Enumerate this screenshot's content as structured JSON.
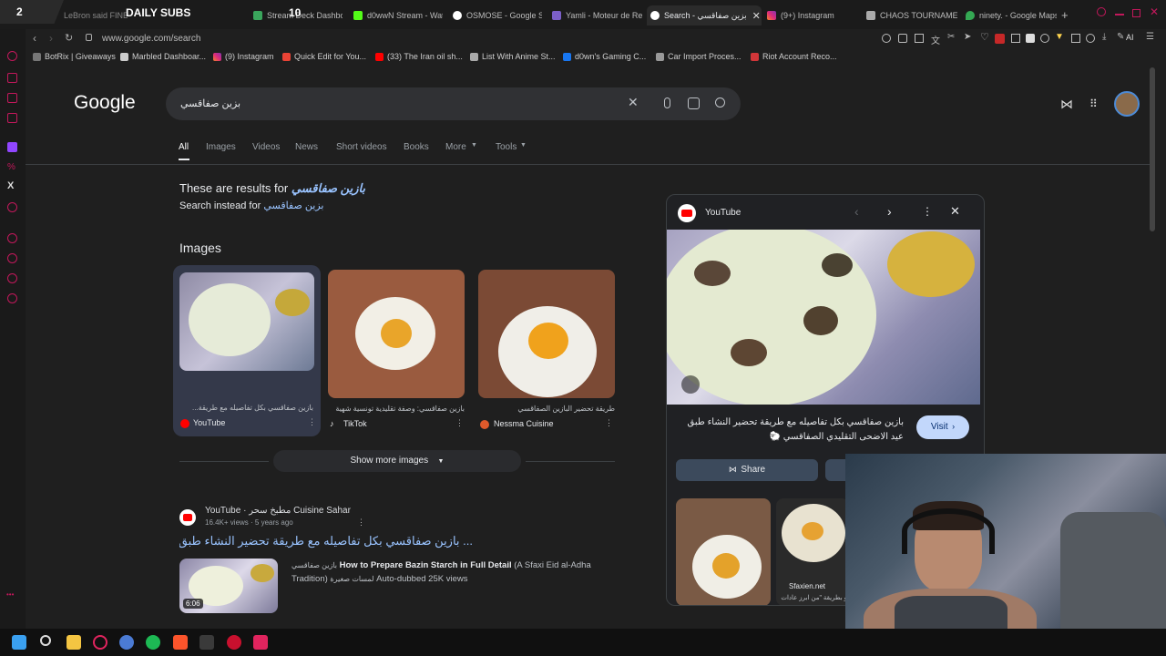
{
  "stream_overlay": {
    "counter_left": "2",
    "counter_mid": "10",
    "brand": "DAILY SUBS"
  },
  "tabs": [
    {
      "label": "LeBron said FINE"
    },
    {
      "label": "Stream Deck Dashbo..."
    },
    {
      "label": "d0wwN Stream - Wat"
    },
    {
      "label": "OSMOSE - Google Se"
    },
    {
      "label": "Yamli - Moteur de Re"
    },
    {
      "label": "Search - بزين صفاقسي",
      "active": true
    },
    {
      "label": "(9+) Instagram"
    },
    {
      "label": "CHAOS TOURNAMEN"
    },
    {
      "label": "ninety. - Google Maps"
    }
  ],
  "address": {
    "url": "www.google.com/search",
    "ai_label": "AI"
  },
  "bookmarks": [
    "BotRix | Giveaways",
    "Marbled Dashboar...",
    "(9) Instagram",
    "Quick Edit for You...",
    "(33) The Iran oil sh...",
    "List With Anime St...",
    "d0wn's Gaming C...",
    "Car Import Proces...",
    "Riot Account Reco..."
  ],
  "google": {
    "logo": "Google",
    "query": "بزين صفاقسي",
    "nav": [
      "All",
      "Images",
      "Videos",
      "News",
      "Short videos",
      "Books",
      "More",
      "Tools"
    ],
    "spell_prefix": "These are results for",
    "spell_corrected": "بازين صفاقسي",
    "search_instead_prefix": "Search instead for",
    "search_instead_term": "بزين صفاقسي",
    "images_heading": "Images",
    "images": [
      {
        "caption": "بازين صفاقسي بكل تفاصيله مع طريقة...",
        "source": "YouTube",
        "source_color": "#ff0000"
      },
      {
        "caption": "بازين صفاقسي: وصفة تقليدية تونسية شهية",
        "source": "TikTok",
        "source_color": "#000000"
      },
      {
        "caption": "طريقة تحضير البازين الصفاقسي",
        "source": "Nessma Cuisine",
        "source_color": "#e05a2b"
      }
    ],
    "show_more": "Show more images",
    "result": {
      "site": "YouTube",
      "channel": "مطبخ سحر Cuisine Sahar",
      "meta": "16.4K+ views · 5 years ago",
      "title": "... بازين صفاقسي بكل تفاصيله مع طريقة تحضير النشاء طبق",
      "snippet_bold": "How to Prepare Bazin Starch in Full Detail",
      "snippet_rest": "(A Sfaxi Eid al-Adha Tradition)",
      "snippet_arabic_1": "بازين صفاقسي",
      "snippet_arabic_2": "لمسات صغيرة",
      "snippet_tail": "Auto-dubbed 25K views",
      "duration": "6:06"
    }
  },
  "panel": {
    "source": "YouTube",
    "title": "بازين صفاقسي بكل تفاصيله مع طريقة تحضير النشاء طبق عيد الاضحى التقليدي الصفاقسي 🐑",
    "visit": "Visit",
    "share": "Share",
    "related_source": "Sfaxien.net",
    "related_caption": "و بطريقة \"من ابرز عادات"
  },
  "colors": {
    "accent": "#8ab4f8",
    "link": "#99c3ff",
    "brand_pink": "#c2185b"
  }
}
